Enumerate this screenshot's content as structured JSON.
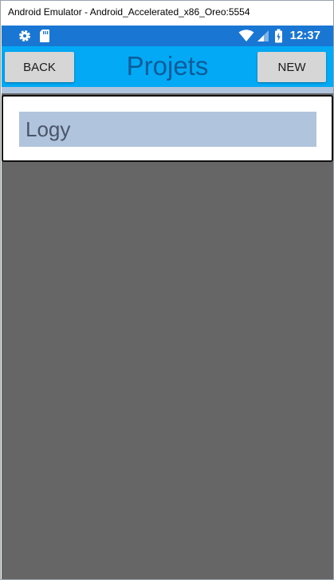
{
  "window": {
    "title": "Android Emulator - Android_Accelerated_x86_Oreo:5554"
  },
  "statusbar": {
    "time": "12:37",
    "icons": [
      "gear-icon",
      "sd-card-icon",
      "wifi-icon",
      "signal-icon",
      "battery-icon"
    ]
  },
  "toolbar": {
    "back_label": "BACK",
    "title": "Projets",
    "new_label": "NEW"
  },
  "projects": [
    {
      "name": "Logy"
    }
  ],
  "colors": {
    "statusbar": "#1976d2",
    "toolbar": "#03a9f4",
    "title": "#0d5c9a",
    "separator": "#b0c4de",
    "item_label_bg": "#b0c4de",
    "screen_bg": "#666666"
  }
}
